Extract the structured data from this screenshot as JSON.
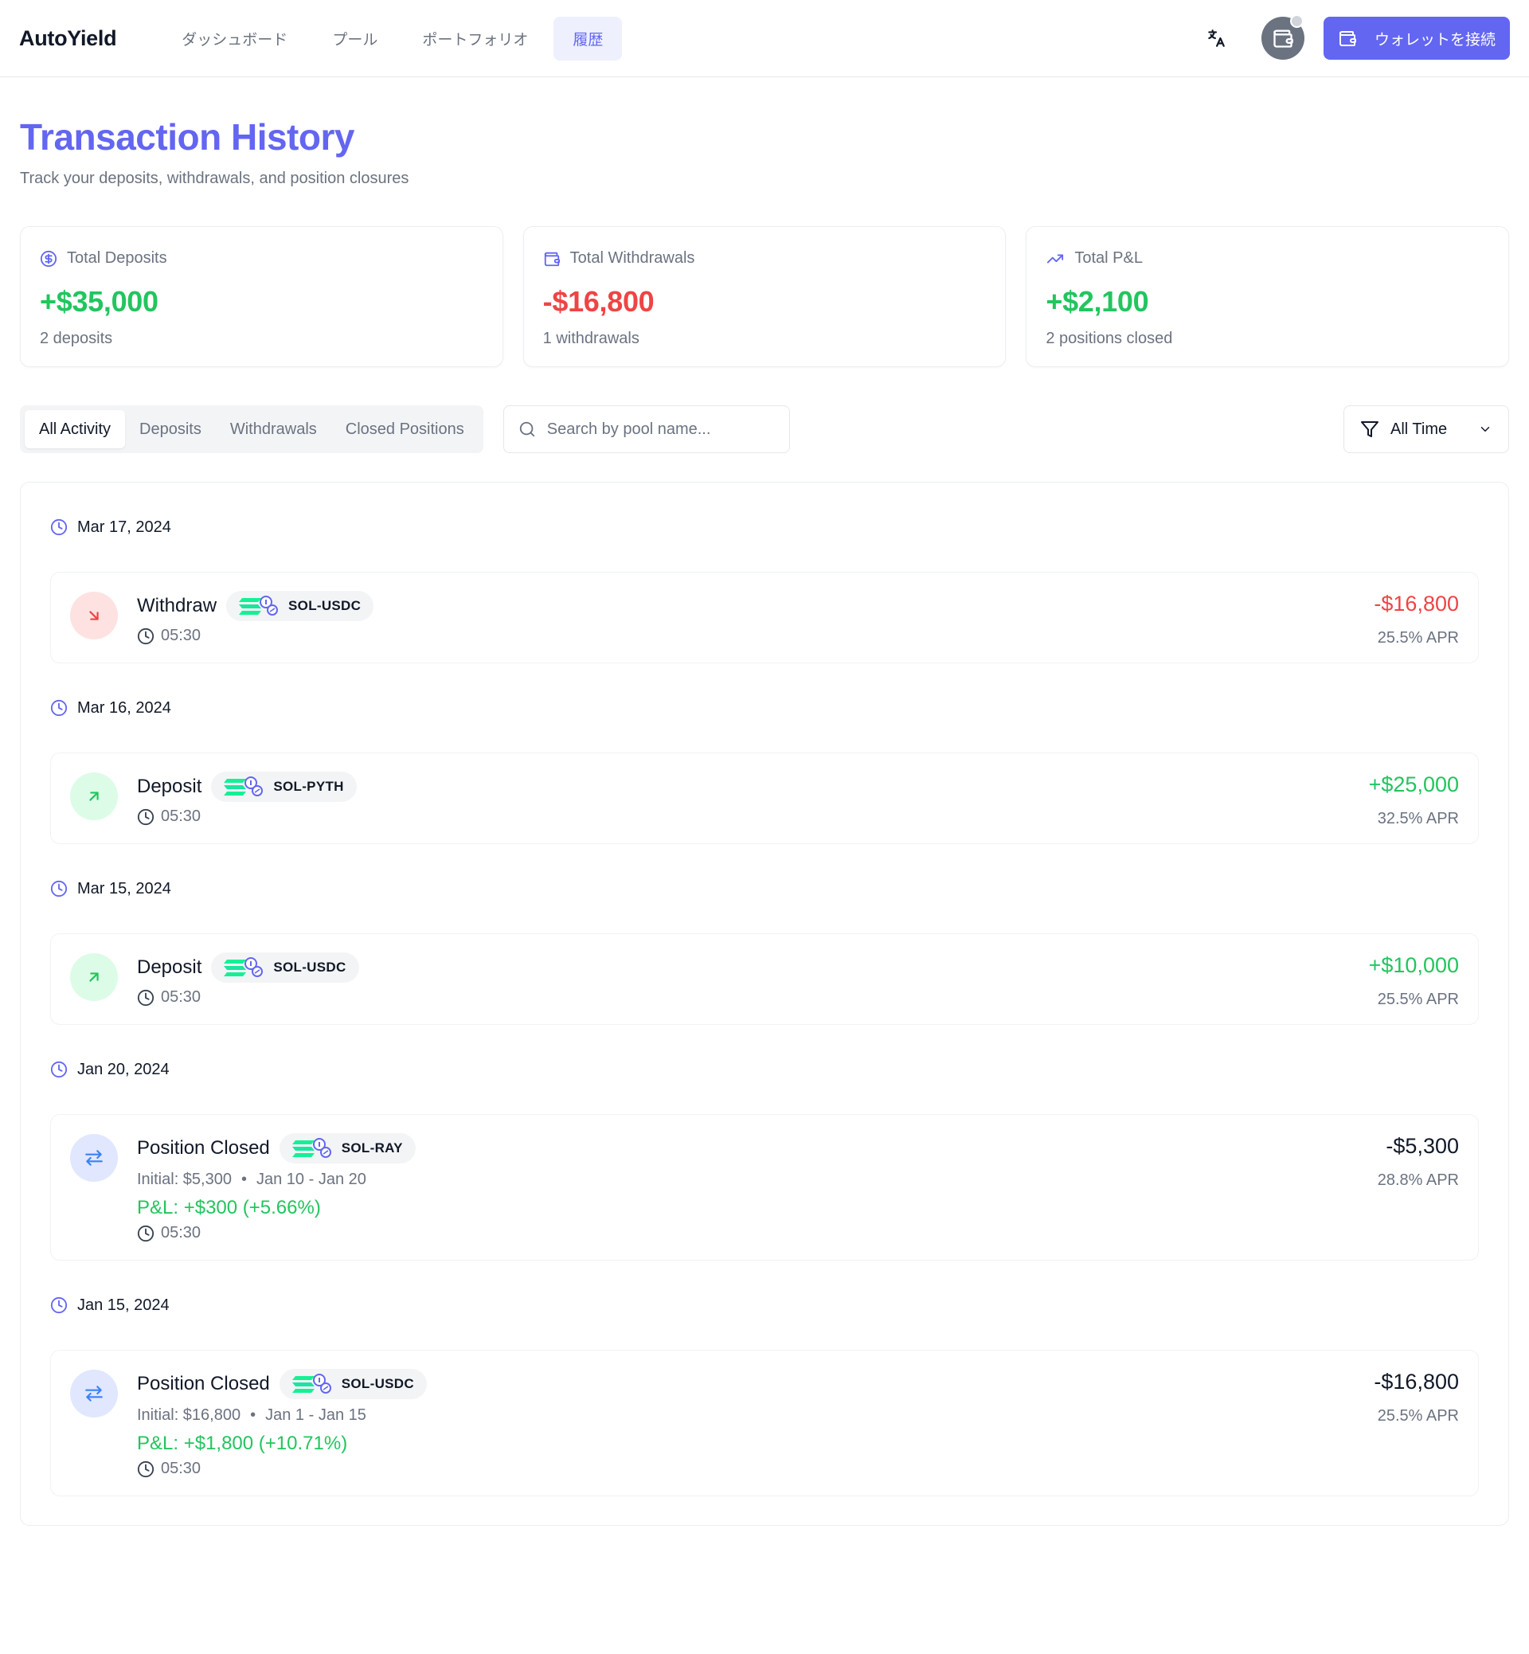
{
  "header": {
    "brand": "AutoYield",
    "nav": [
      "ダッシュボード",
      "プール",
      "ポートフォリオ",
      "履歴"
    ],
    "active_nav": "履歴",
    "connect_label": "ウォレットを接続"
  },
  "page": {
    "title": "Transaction History",
    "subtitle": "Track your deposits, withdrawals, and position closures"
  },
  "stats": [
    {
      "label": "Total Deposits",
      "value": "+$35,000",
      "sub": "2 deposits",
      "icon": "dollar-circle-icon",
      "tone": "green"
    },
    {
      "label": "Total Withdrawals",
      "value": "-$16,800",
      "sub": "1 withdrawals",
      "icon": "wallet-icon",
      "tone": "red"
    },
    {
      "label": "Total P&L",
      "value": "+$2,100",
      "sub": "2 positions closed",
      "icon": "trending-up-icon",
      "tone": "green"
    }
  ],
  "filters": {
    "tabs": [
      "All Activity",
      "Deposits",
      "Withdrawals",
      "Closed Positions"
    ],
    "active_tab": "All Activity",
    "search_placeholder": "Search by pool name...",
    "time_filter": "All Time"
  },
  "groups": [
    {
      "date": "Mar 17, 2024",
      "tx": {
        "type": "Withdraw",
        "kind": "wd",
        "pool": "SOL-USDC",
        "time": "05:30",
        "amount": "-$16,800",
        "amount_tone": "red",
        "apr": "25.5% APR"
      }
    },
    {
      "date": "Mar 16, 2024",
      "tx": {
        "type": "Deposit",
        "kind": "dp",
        "pool": "SOL-PYTH",
        "time": "05:30",
        "amount": "+$25,000",
        "amount_tone": "green",
        "apr": "32.5% APR"
      }
    },
    {
      "date": "Mar 15, 2024",
      "tx": {
        "type": "Deposit",
        "kind": "dp",
        "pool": "SOL-USDC",
        "time": "05:30",
        "amount": "+$10,000",
        "amount_tone": "green",
        "apr": "25.5% APR"
      }
    },
    {
      "date": "Jan 20, 2024",
      "tx": {
        "type": "Position Closed",
        "kind": "pc",
        "pool": "SOL-RAY",
        "initial": "Initial: $5,300",
        "range": "Jan 10 - Jan 20",
        "pnl": "P&L: +$300 (+5.66%)",
        "time": "05:30",
        "amount": "-$5,300",
        "amount_tone": "dark",
        "apr": "28.8% APR"
      }
    },
    {
      "date": "Jan 15, 2024",
      "tx": {
        "type": "Position Closed",
        "kind": "pc",
        "pool": "SOL-USDC",
        "initial": "Initial: $16,800",
        "range": "Jan 1 - Jan 15",
        "pnl": "P&L: +$1,800 (+10.71%)",
        "time": "05:30",
        "amount": "-$16,800",
        "amount_tone": "dark",
        "apr": "25.5% APR"
      }
    }
  ],
  "colors": {
    "accent": "#6366f1",
    "green": "#22c55e",
    "red": "#ef4444",
    "muted": "#6b7280"
  }
}
